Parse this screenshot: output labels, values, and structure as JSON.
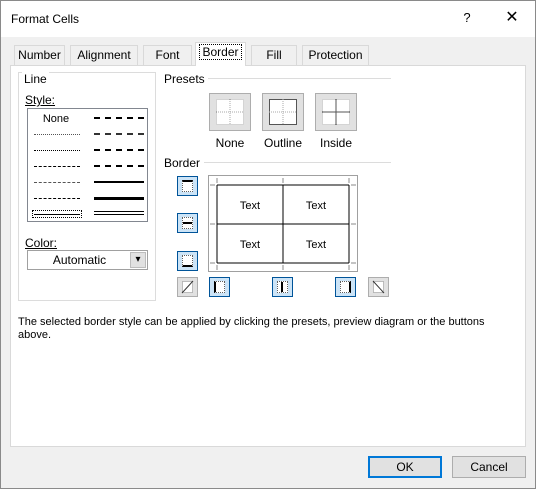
{
  "dialog": {
    "title": "Format Cells",
    "help_label": "?",
    "close_label": "✕"
  },
  "tabs": [
    {
      "label": "Number",
      "active": false
    },
    {
      "label": "Alignment",
      "active": false
    },
    {
      "label": "Font",
      "active": false
    },
    {
      "label": "Border",
      "active": true
    },
    {
      "label": "Fill",
      "active": false
    },
    {
      "label": "Protection",
      "active": false
    }
  ],
  "line_group": {
    "legend": "Line",
    "style_label": "Style:",
    "style_none": "None",
    "color_label": "Color:",
    "color_value": "Automatic",
    "dropdown_arrow": "▾"
  },
  "presets": {
    "legend": "Presets",
    "items": [
      {
        "label": "None",
        "icon": "preset-none-icon"
      },
      {
        "label": "Outline",
        "icon": "preset-outline-icon"
      },
      {
        "label": "Inside",
        "icon": "preset-inside-icon"
      }
    ]
  },
  "border": {
    "legend": "Border",
    "preview_cells": [
      "Text",
      "Text",
      "Text",
      "Text"
    ]
  },
  "description": "The selected border style can be applied by clicking the presets, preview diagram or the buttons above.",
  "buttons": {
    "ok": "OK",
    "cancel": "Cancel"
  },
  "colors": {
    "accent": "#0078d7",
    "selected_button_bg": "#cce4f7",
    "dialog_bg": "#f0f0f0"
  }
}
